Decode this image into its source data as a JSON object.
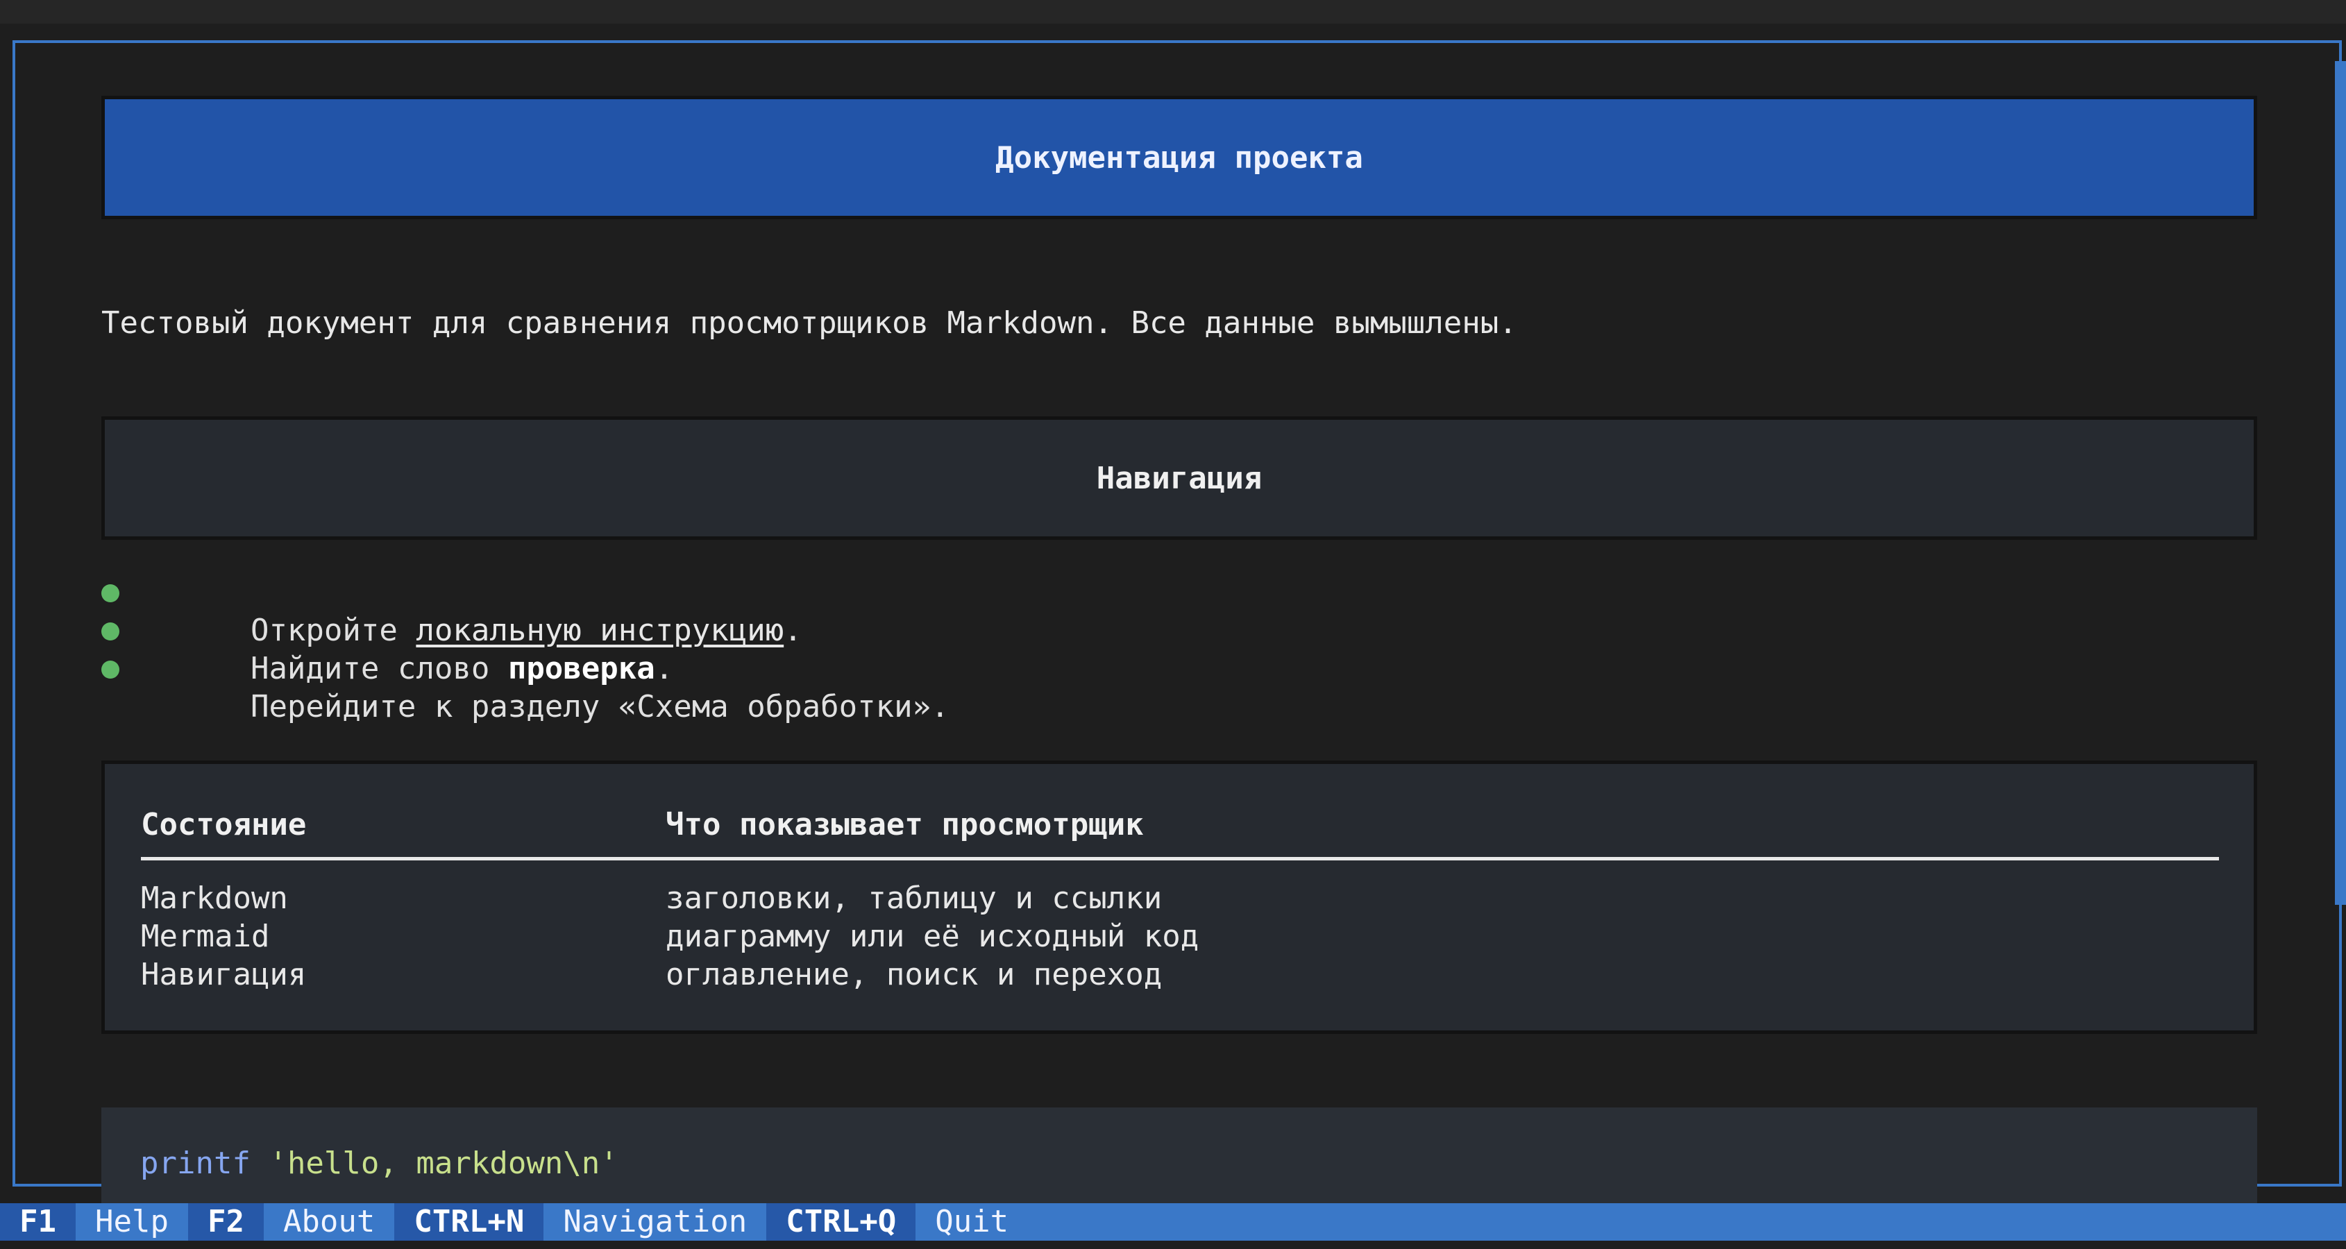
{
  "document": {
    "title": "Документация проекта",
    "intro": "Тестовый документ для сравнения просмотрщиков Markdown. Все данные вымышлены.",
    "nav_heading": "Навигация",
    "bullets": [
      {
        "before": "Откройте ",
        "link": "локальную инструкцию",
        "after": "."
      },
      {
        "before": "Найдите слово ",
        "strong": "проверка",
        "after": "."
      },
      {
        "text": "Перейдите к разделу «Схема обработки»."
      }
    ],
    "table": {
      "headers": [
        "Состояние",
        "Что показывает просмотрщик"
      ],
      "rows": [
        [
          "Markdown",
          "заголовки, таблицу и ссылки"
        ],
        [
          "Mermaid",
          "диаграмму или её исходный код"
        ],
        [
          "Навигация",
          "оглавление, поиск и переход"
        ]
      ]
    },
    "code": {
      "command": "printf",
      "argument": "'hello, markdown\\n'"
    }
  },
  "statusbar": {
    "items": [
      {
        "key": "F1",
        "label": "Help"
      },
      {
        "key": "F2",
        "label": "About"
      },
      {
        "key": "CTRL+N",
        "label": "Navigation"
      },
      {
        "key": "CTRL+Q",
        "label": "Quit"
      }
    ]
  },
  "colors": {
    "accent": "#3a78c8",
    "heading_bg": "#2254a8",
    "bullet": "#5fb866",
    "code_keyword": "#86a6f0",
    "code_string": "#c8e08c"
  }
}
